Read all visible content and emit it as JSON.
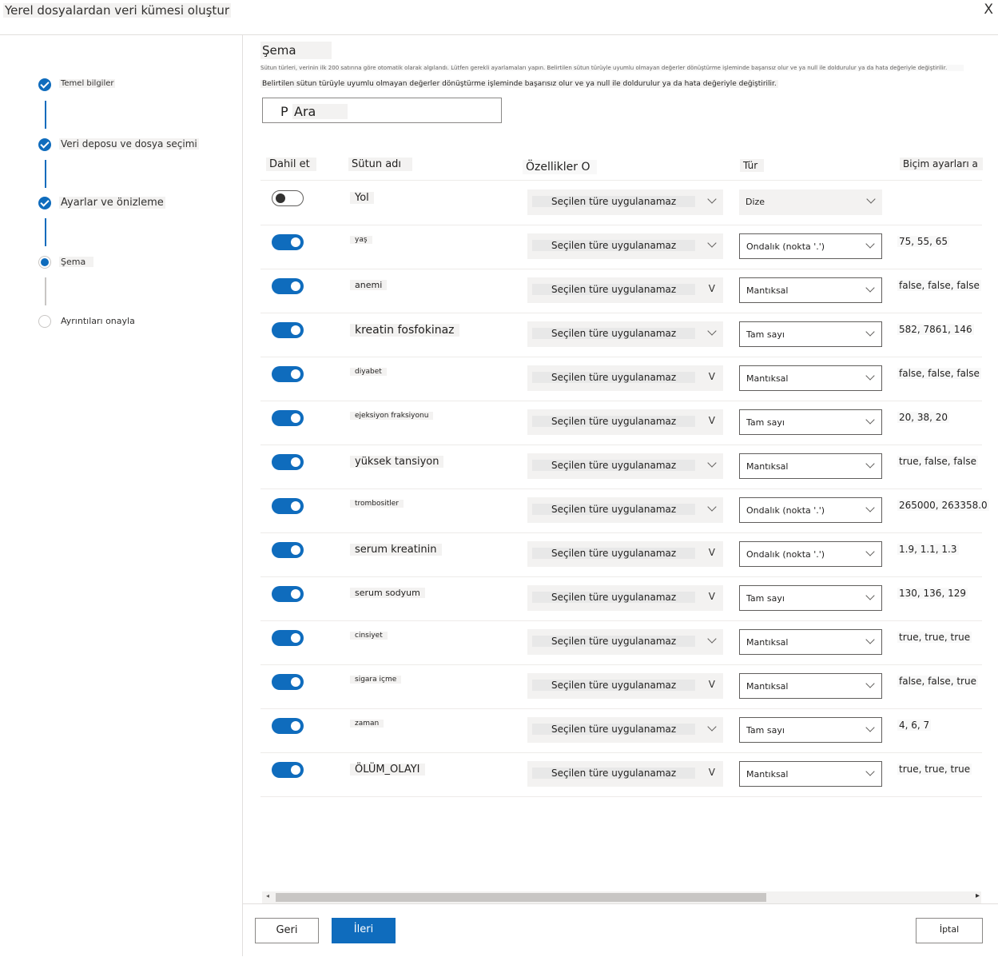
{
  "window": {
    "title": "Yerel dosyalardan veri kümesi oluştur",
    "close_label": "X"
  },
  "steps": [
    {
      "label": "Temel bilgiler",
      "state": "done"
    },
    {
      "label": "Veri deposu ve dosya seçimi",
      "state": "done"
    },
    {
      "label": "Ayarlar ve önizleme",
      "state": "done"
    },
    {
      "label": "Şema",
      "state": "current"
    },
    {
      "label": "Ayrıntıları onayla",
      "state": "todo"
    }
  ],
  "schema": {
    "title": "Şema",
    "description": "Sütun türleri, verinin ilk 200 satırına göre otomatik olarak algılandı. Lütfen gerekli ayarlamaları yapın. Belirtilen sütun türüyle uyumlu olmayan değerler dönüştürme işleminde başarısız olur ve ya null ile doldurulur ya da hata değeriyle değiştirilir.",
    "note": "Belirtilen sütun türüyle uyumlu olmayan değerler dönüştürme işleminde başarısız olur ve ya null ile doldurulur ya da hata değeriyle değiştirilir.",
    "search_icon": "P",
    "search_placeholder": "Ara",
    "headers": {
      "include": "Dahil et",
      "column_name": "Sütun adı",
      "properties": "Özellikler O",
      "type": "Tür",
      "format": "Biçim ayarları a"
    },
    "rows": [
      {
        "include": false,
        "name": "Yol",
        "property": "Seçilen türe uygulanamaz",
        "type": "Dize",
        "format": ""
      },
      {
        "include": true,
        "name": "yaş",
        "property": "Seçilen türe uygulanamaz",
        "type": "Ondalık (nokta '.')",
        "format": "75, 55, 65"
      },
      {
        "include": true,
        "name": "anemi",
        "property": "Seçilen türe uygulanamaz",
        "type": "Mantıksal",
        "format": "false, false, false"
      },
      {
        "include": true,
        "name": "kreatin fosfokinaz",
        "property": "Seçilen türe uygulanamaz",
        "type": "Tam sayı",
        "format": "582, 7861, 146"
      },
      {
        "include": true,
        "name": "diyabet",
        "property": "Seçilen türe uygulanamaz",
        "type": "Mantıksal",
        "format": "false, false, false"
      },
      {
        "include": true,
        "name": "ejeksiyon fraksiyonu",
        "property": "Seçilen türe uygulanamaz",
        "type": "Tam sayı",
        "format": "20, 38, 20"
      },
      {
        "include": true,
        "name": "yüksek tansiyon",
        "property": "Seçilen türe uygulanamaz",
        "type": "Mantıksal",
        "format": "true, false, false"
      },
      {
        "include": true,
        "name": "trombositler",
        "property": "Seçilen türe uygulanamaz",
        "type": "Ondalık (nokta '.')",
        "format": "265000, 263358.0"
      },
      {
        "include": true,
        "name": "serum kreatinin",
        "property": "Seçilen türe uygulanamaz",
        "type": "Ondalık (nokta '.')",
        "format": "1.9, 1.1, 1.3"
      },
      {
        "include": true,
        "name": "serum sodyum",
        "property": "Seçilen türe uygulanamaz",
        "type": "Tam sayı",
        "format": "130, 136, 129"
      },
      {
        "include": true,
        "name": "cinsiyet",
        "property": "Seçilen türe uygulanamaz",
        "type": "Mantıksal",
        "format": "true, true, true"
      },
      {
        "include": true,
        "name": "sigara içme",
        "property": "Seçilen türe uygulanamaz",
        "type": "Mantıksal",
        "format": "false, false, true"
      },
      {
        "include": true,
        "name": "zaman",
        "property": "Seçilen türe uygulanamaz",
        "type": "Tam sayı",
        "format": "4, 6, 7"
      },
      {
        "include": true,
        "name": "ÖLÜM_OLAYI",
        "property": "Seçilen türe uygulanamaz",
        "type": "Mantıksal",
        "format": "true, true, true"
      }
    ]
  },
  "footer": {
    "back": "Geri",
    "next": "İleri",
    "cancel": "İptal"
  },
  "colors": {
    "accent": "#0f6cbd",
    "border": "#8a8886",
    "divider": "#edebe9"
  }
}
